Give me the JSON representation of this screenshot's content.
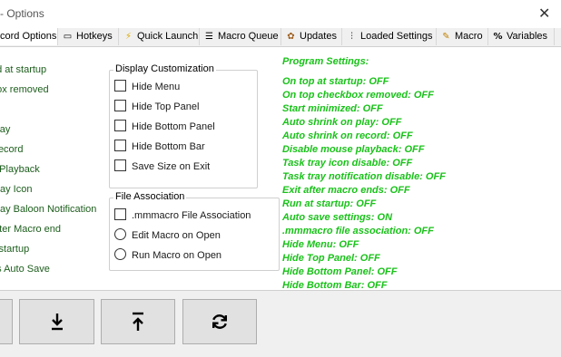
{
  "window": {
    "title": "o - Options",
    "close_glyph": "✕"
  },
  "tabs": [
    {
      "label": "cord Options",
      "icon": "",
      "active": true
    },
    {
      "label": "Hotkeys",
      "icon": "▭"
    },
    {
      "label": "Quick Launch",
      "icon": "⚡"
    },
    {
      "label": "Macro Queue",
      "icon": "☰"
    },
    {
      "label": "Updates",
      "icon": "✿"
    },
    {
      "label": "Loaded Settings",
      "icon": "⫶"
    },
    {
      "label": "Macro",
      "icon": "✎"
    },
    {
      "label": "Variables",
      "icon": "%"
    },
    {
      "label": "",
      "icon": "•"
    }
  ],
  "left_options": [
    "ed at startup",
    " box removed",
    "d",
    " Play",
    " Record",
    "e Playback",
    "Tray Icon",
    "Tray Baloon Notification",
    "after Macro end",
    "s startup",
    "gs Auto Save"
  ],
  "display_customization": {
    "title": "Display Customization",
    "options": [
      "Hide Menu",
      "Hide Top Panel",
      "Hide Bottom Panel",
      "Hide Bottom Bar",
      "Save Size on Exit"
    ]
  },
  "file_association": {
    "title": "File Association",
    "checkbox": ".mmmacro File Association",
    "radios": [
      "Edit Macro on Open",
      "Run Macro on Open"
    ]
  },
  "program_settings": [
    "Program Settings:",
    "",
    "On top at startup: OFF",
    "On top checkbox removed: OFF",
    "Start minimized: OFF",
    "Auto shrink on play: OFF",
    "Auto shrink on record: OFF",
    "Disable mouse playback: OFF",
    "Task tray icon disable: OFF",
    "Task tray notification disable: OFF",
    "Exit after macro ends: OFF",
    "Run at startup: OFF",
    "Auto save settings: ON",
    ".mmmacro file association: OFF",
    "Hide Menu: OFF",
    "Hide Top Panel: OFF",
    "Hide Bottom Panel: OFF",
    "Hide Bottom Bar: OFF"
  ],
  "buttons": [
    {
      "name": "partial-button",
      "icon": ""
    },
    {
      "name": "import-button",
      "icon": "download-arrow-icon"
    },
    {
      "name": "export-button",
      "icon": "upload-arrow-icon"
    },
    {
      "name": "refresh-button",
      "icon": "refresh-icon"
    }
  ],
  "colors": {
    "settings_text": "#19c219",
    "left_text": "#1c5d1c"
  }
}
